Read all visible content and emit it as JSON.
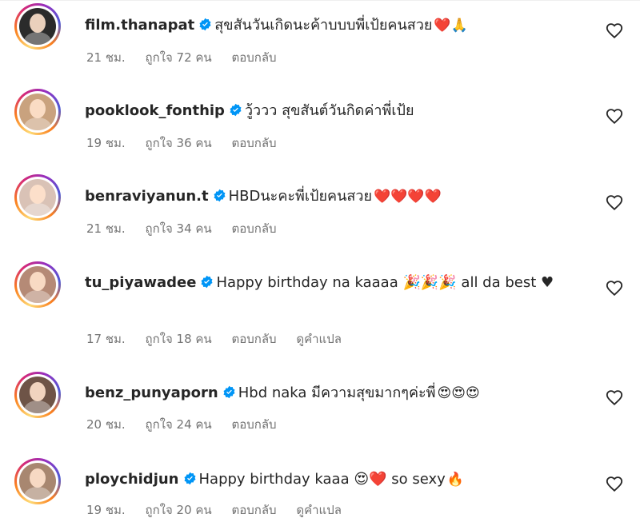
{
  "comments": [
    {
      "username": "film.thanapat",
      "text": "สุขสันวันเกิดนะค้าบบบพี่เป้ยคนสวย",
      "emojis": "❤️🙏",
      "time": "21 ชม.",
      "likes": "ถูกใจ 72 คน",
      "reply": "ตอบกลับ",
      "translate": "",
      "avatar_color": "#2b2b2b"
    },
    {
      "username": "pooklook_fonthip",
      "text": "วู้ววว สุขสันต์วันกิดค่าพี่เป้ย",
      "emojis": "",
      "time": "19 ชม.",
      "likes": "ถูกใจ 36 คน",
      "reply": "ตอบกลับ",
      "translate": "",
      "avatar_color": "#c9a27e"
    },
    {
      "username": "benraviyanun.t",
      "text": "HBDนะคะพี่เป้ยคนสวย",
      "emojis": "❤️❤️❤️❤️",
      "time": "21 ชม.",
      "likes": "ถูกใจ 34 คน",
      "reply": "ตอบกลับ",
      "translate": "",
      "avatar_color": "#d9c2b6"
    },
    {
      "username": "tu_piyawadee",
      "text": "Happy birthday na kaaaa 🎉🎉🎉 all da best ♥",
      "emojis": "",
      "time": "17 ชม.",
      "likes": "ถูกใจ 18 คน",
      "reply": "ตอบกลับ",
      "translate": "ดูคำแปล",
      "avatar_color": "#b58a76"
    },
    {
      "username": "benz_punyaporn",
      "text": "Hbd naka มีความสุขมากๆค่ะพี่",
      "emojis": "😍😍😍",
      "time": "20 ชม.",
      "likes": "ถูกใจ 24 คน",
      "reply": "ตอบกลับ",
      "translate": "",
      "avatar_color": "#6e5447"
    },
    {
      "username": "ploychidjun",
      "text": "Happy birthday kaaa 😍❤️ so sexy",
      "emojis": "🔥",
      "time": "19 ชม.",
      "likes": "ถูกใจ 20 คน",
      "reply": "ตอบกลับ",
      "translate": "ดูคำแปล",
      "avatar_color": "#a88770"
    }
  ],
  "colors": {
    "verified": "#0095f6",
    "meta": "#737373",
    "text": "#262626"
  }
}
